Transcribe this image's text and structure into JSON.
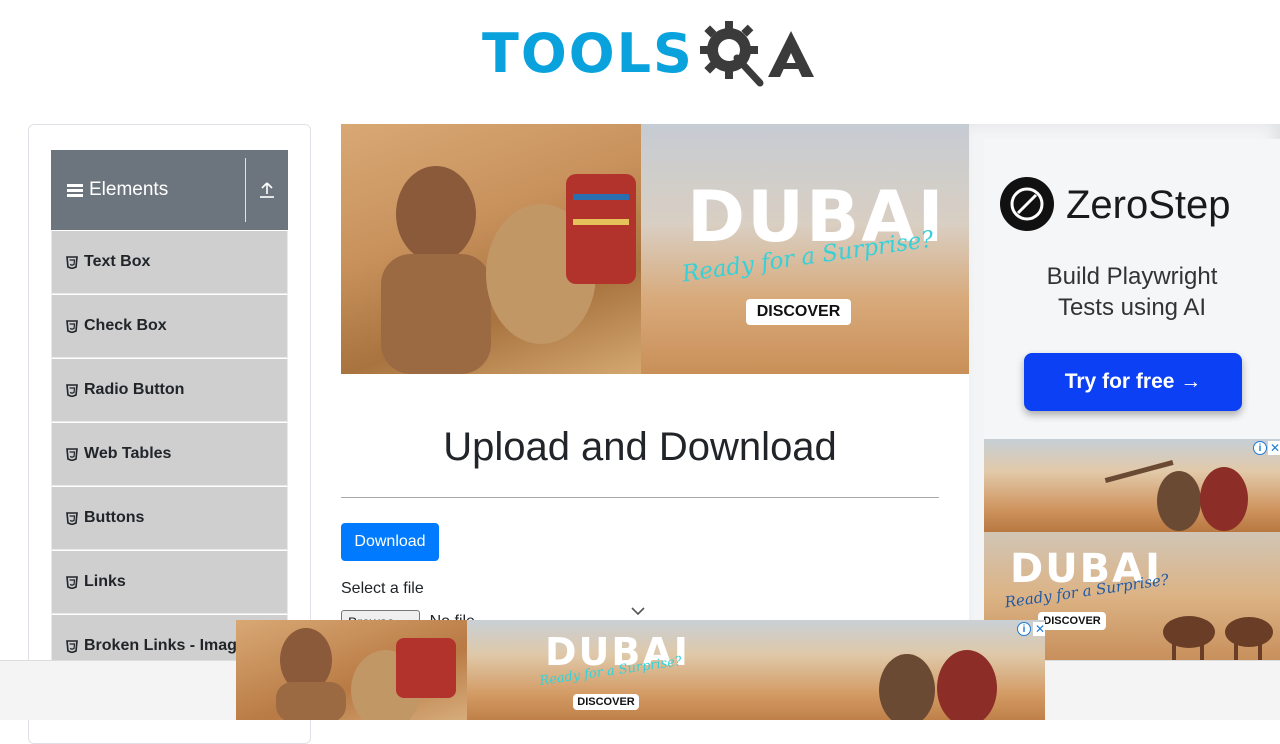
{
  "brand": {
    "logo_text": "TOOLS",
    "logo_suffix": "A"
  },
  "sidebar": {
    "group_title": "Elements",
    "items": [
      {
        "label": "Text Box"
      },
      {
        "label": "Check Box"
      },
      {
        "label": "Radio Button"
      },
      {
        "label": "Web Tables"
      },
      {
        "label": "Buttons"
      },
      {
        "label": "Links"
      },
      {
        "label": "Broken Links - Images"
      }
    ]
  },
  "main_ad": {
    "headline": "DUBAI",
    "tagline": "Ready for a Surprise?",
    "cta": "DISCOVER"
  },
  "page": {
    "title": "Upload and Download",
    "download_label": "Download",
    "select_label": "Select a file",
    "file_button": "Browse...",
    "file_status": "No file selected."
  },
  "zerostep_ad": {
    "name": "ZeroStep",
    "tagline": "Build Playwright Tests using AI",
    "cta": "Try for free →"
  },
  "side_ad": {
    "headline": "DUBAI",
    "tagline": "Ready for a Surprise?",
    "cta": "DISCOVER"
  },
  "bottom_ad": {
    "headline": "DUBAI",
    "tagline": "Ready for a Surprise?",
    "cta": "DISCOVER"
  },
  "ad_controls": {
    "info": "i",
    "close": "✕"
  },
  "colors": {
    "brand_blue": "#0aa2dc",
    "primary": "#007bff",
    "sidebar_header": "#6c757d",
    "cta_blue": "#0b40f5"
  }
}
